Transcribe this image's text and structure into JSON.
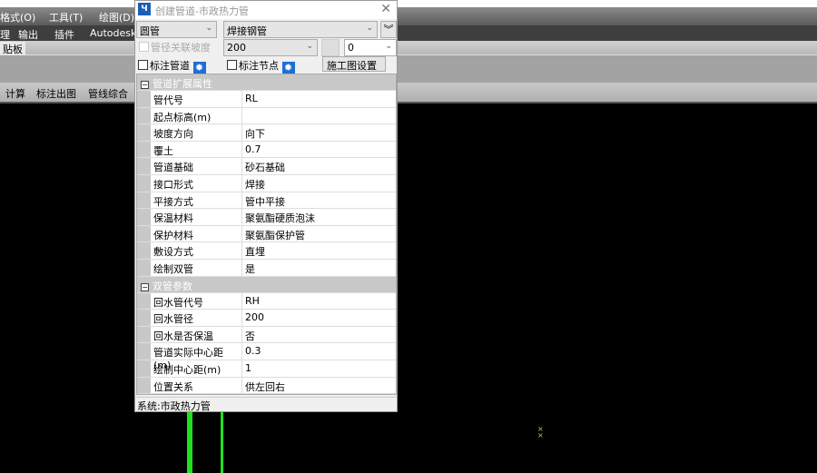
{
  "app": {
    "menus": [
      "格式(O)",
      "工具(T)",
      "绘图(D)"
    ],
    "ribbon_tabs": [
      "理",
      "输出",
      "插件",
      "Autodesk"
    ],
    "panel_tab": "贴板",
    "toolbar": [
      "计算",
      "标注出图",
      "管线综合"
    ]
  },
  "dialog": {
    "title": "创建管道-市政热力管",
    "shape_select": "圆管",
    "material_select": "焊接钢管",
    "link_slope_label": "管径关联坡度",
    "diameter_select": "200",
    "offset_select": "0",
    "mark_pipe_label": "标注管道",
    "mark_node_label": "标注节点",
    "construction_button": "施工图设置",
    "sections": [
      {
        "title": "管道扩展属性",
        "rows": [
          [
            "管代号",
            "RL"
          ],
          [
            "起点标高(m)",
            ""
          ],
          [
            "坡度方向",
            "向下"
          ],
          [
            "覆土",
            "0.7"
          ],
          [
            "管道基础",
            "砂石基础"
          ],
          [
            "接口形式",
            "焊接"
          ],
          [
            "平接方式",
            "管中平接"
          ],
          [
            "保温材料",
            "聚氨酯硬质泡沫"
          ],
          [
            "保护材料",
            "聚氨酯保护管"
          ],
          [
            "敷设方式",
            "直埋"
          ],
          [
            "绘制双管",
            "是"
          ]
        ]
      },
      {
        "title": "双管参数",
        "rows": [
          [
            "回水管代号",
            "RH"
          ],
          [
            "回水管径",
            "200"
          ],
          [
            "回水是否保温",
            "否"
          ],
          [
            "管道实际中心距(m)",
            "0.3"
          ],
          [
            "绘制中心距(m)",
            "1"
          ],
          [
            "位置关系",
            "供左回右"
          ]
        ]
      }
    ],
    "status": "系统:市政热力管"
  },
  "colors": {
    "pipe": "#1fe01f",
    "gear": "#1d6fd6",
    "canvas": "#000000"
  }
}
